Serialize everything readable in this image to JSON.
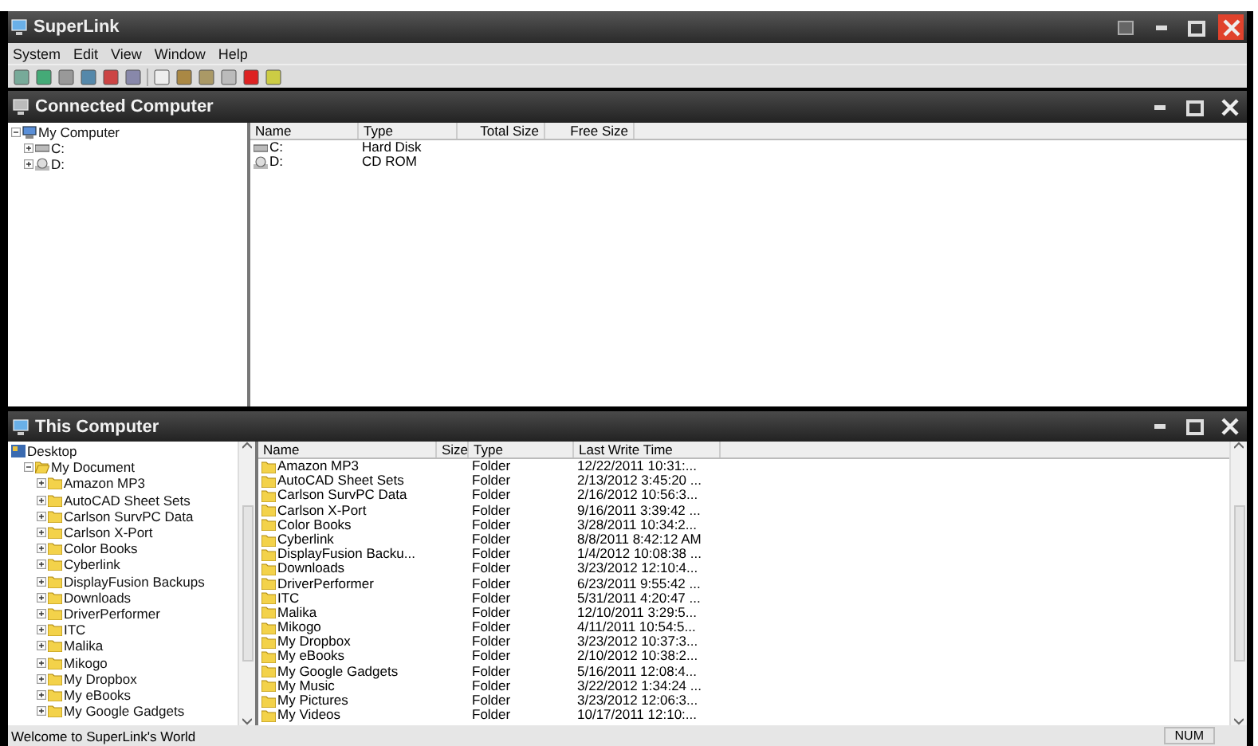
{
  "window": {
    "title": "SuperLink"
  },
  "menu": [
    "System",
    "Edit",
    "View",
    "Window",
    "Help"
  ],
  "connected": {
    "title": "Connected Computer",
    "tree": [
      {
        "label": "My Computer",
        "kind": "computer",
        "expanded": true,
        "children": [
          {
            "label": "C:",
            "kind": "disk",
            "expanded": false
          },
          {
            "label": "D:",
            "kind": "cd",
            "expanded": false
          }
        ]
      }
    ],
    "columns": [
      "Name",
      "Type",
      "Total Size",
      "Free Size"
    ],
    "rows": [
      {
        "kind": "disk",
        "cells": [
          "C:",
          "Hard Disk"
        ]
      },
      {
        "kind": "cd",
        "cells": [
          "D:",
          "CD ROM"
        ]
      }
    ]
  },
  "local": {
    "title": "This Computer",
    "tree": [
      {
        "label": "Desktop",
        "kind": "desktop",
        "children": [
          {
            "label": "My Document",
            "kind": "folder-open",
            "expanded": true,
            "children": [
              {
                "label": "Amazon MP3",
                "kind": "folder",
                "expanded": false
              },
              {
                "label": "AutoCAD Sheet Sets",
                "kind": "folder",
                "expanded": false
              },
              {
                "label": "Carlson SurvPC Data",
                "kind": "folder",
                "expanded": false
              },
              {
                "label": "Carlson X-Port",
                "kind": "folder",
                "expanded": false
              },
              {
                "label": "Color Books",
                "kind": "folder",
                "expanded": false
              },
              {
                "label": "Cyberlink",
                "kind": "folder",
                "expanded": false
              },
              {
                "label": "DisplayFusion Backups",
                "kind": "folder",
                "expanded": false
              },
              {
                "label": "Downloads",
                "kind": "folder",
                "expanded": false
              },
              {
                "label": "DriverPerformer",
                "kind": "folder",
                "expanded": false
              },
              {
                "label": "ITC",
                "kind": "folder",
                "expanded": false
              },
              {
                "label": "Malika",
                "kind": "folder",
                "expanded": false
              },
              {
                "label": "Mikogo",
                "kind": "folder",
                "expanded": false
              },
              {
                "label": "My Dropbox",
                "kind": "folder",
                "expanded": false
              },
              {
                "label": "My eBooks",
                "kind": "folder",
                "expanded": false
              },
              {
                "label": "My Google Gadgets",
                "kind": "folder",
                "expanded": false
              }
            ]
          }
        ]
      }
    ],
    "columns": [
      "Name",
      "Size",
      "Type",
      "Last Write Time"
    ],
    "rows": [
      {
        "kind": "folder",
        "cells": [
          "Amazon MP3",
          "",
          "Folder",
          "12/22/2011 10:31:..."
        ]
      },
      {
        "kind": "folder",
        "cells": [
          "AutoCAD Sheet Sets",
          "",
          "Folder",
          "2/13/2012 3:45:20 ..."
        ]
      },
      {
        "kind": "folder",
        "cells": [
          "Carlson SurvPC Data",
          "",
          "Folder",
          "2/16/2012 10:56:3..."
        ]
      },
      {
        "kind": "folder",
        "cells": [
          "Carlson X-Port",
          "",
          "Folder",
          "9/16/2011 3:39:42 ..."
        ]
      },
      {
        "kind": "folder",
        "cells": [
          "Color Books",
          "",
          "Folder",
          "3/28/2011 10:34:2..."
        ]
      },
      {
        "kind": "folder",
        "cells": [
          "Cyberlink",
          "",
          "Folder",
          "8/8/2011 8:42:12 AM"
        ]
      },
      {
        "kind": "folder",
        "cells": [
          "DisplayFusion Backu...",
          "",
          "Folder",
          "1/4/2012 10:08:38 ..."
        ]
      },
      {
        "kind": "folder",
        "cells": [
          "Downloads",
          "",
          "Folder",
          "3/23/2012 12:10:4..."
        ]
      },
      {
        "kind": "folder",
        "cells": [
          "DriverPerformer",
          "",
          "Folder",
          "6/23/2011 9:55:42 ..."
        ]
      },
      {
        "kind": "folder",
        "cells": [
          "ITC",
          "",
          "Folder",
          "5/31/2011 4:20:47 ..."
        ]
      },
      {
        "kind": "folder",
        "cells": [
          "Malika",
          "",
          "Folder",
          "12/10/2011 3:29:5..."
        ]
      },
      {
        "kind": "folder",
        "cells": [
          "Mikogo",
          "",
          "Folder",
          "4/11/2011 10:54:5..."
        ]
      },
      {
        "kind": "folder",
        "cells": [
          "My Dropbox",
          "",
          "Folder",
          "3/23/2012 10:37:3..."
        ]
      },
      {
        "kind": "folder",
        "cells": [
          "My eBooks",
          "",
          "Folder",
          "2/10/2012 10:38:2..."
        ]
      },
      {
        "kind": "folder",
        "cells": [
          "My Google Gadgets",
          "",
          "Folder",
          "5/16/2011 12:08:4..."
        ]
      },
      {
        "kind": "folder",
        "cells": [
          "My Music",
          "",
          "Folder",
          "3/22/2012 1:34:24 ..."
        ]
      },
      {
        "kind": "folder",
        "cells": [
          "My Pictures",
          "",
          "Folder",
          "3/23/2012 12:06:3..."
        ]
      },
      {
        "kind": "folder",
        "cells": [
          "My Videos",
          "",
          "Folder",
          "10/17/2011 12:10:..."
        ]
      }
    ]
  },
  "status_bar": {
    "message": "Welcome to SuperLink's World",
    "indicator": "NUM"
  }
}
